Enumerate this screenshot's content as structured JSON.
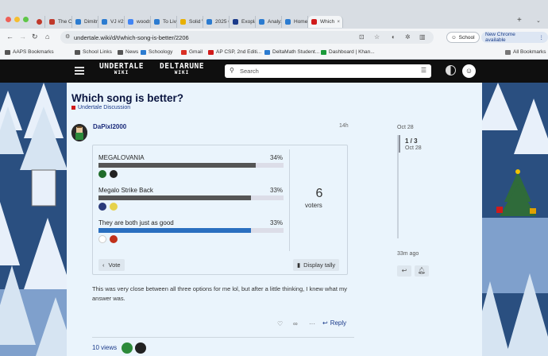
{
  "browser": {
    "tabs": [
      {
        "title": "The Or",
        "color": "#c0392b"
      },
      {
        "title": "Dimitri",
        "color": "#2b7bd0"
      },
      {
        "title": "VJ #2 -",
        "color": "#2b7bd0"
      },
      {
        "title": "woods",
        "color": "#4285f4"
      },
      {
        "title": "To Livi",
        "color": "#2b7bd0"
      },
      {
        "title": "Solid W",
        "color": "#e8b000"
      },
      {
        "title": "2025 C",
        "color": "#2b7bd0"
      },
      {
        "title": "Exoplan",
        "color": "#1a3a8a"
      },
      {
        "title": "Analyz",
        "color": "#2b7bd0"
      },
      {
        "title": "Home |",
        "color": "#2b7bd0"
      },
      {
        "title": "Which",
        "color": "#d01a1a"
      }
    ],
    "new_tab": "+",
    "url": "undertale.wiki/d/t/which-song-is-better/2206",
    "profile": "School",
    "update_label": "New Chrome available",
    "bookmarks": [
      {
        "label": "AAPS Bookmarks",
        "color": "#555"
      },
      {
        "label": "School Links",
        "color": "#555"
      },
      {
        "label": "News",
        "color": "#555"
      },
      {
        "label": "Schoology",
        "color": "#2b7bd0"
      },
      {
        "label": "Gmail",
        "color": "#d93025"
      },
      {
        "label": "AP CSP, 2nd Editi...",
        "color": "#d01a1a"
      },
      {
        "label": "DeltaMath Student...",
        "color": "#2b7bd0"
      },
      {
        "label": "Dashboard | Khan...",
        "color": "#1a9a3a"
      }
    ],
    "all_bookmarks": "All Bookmarks"
  },
  "site": {
    "logo_undertale": "UNDERTALE",
    "logo_deltarune": "DELTARUNE",
    "logo_wiki": "WIKI",
    "search_placeholder": "Search"
  },
  "topic": {
    "title": "Which song is better?",
    "category": "Undertale Discussion",
    "category_color": "#d01a1a"
  },
  "post": {
    "username": "DaPixl2000",
    "age": "14h",
    "body": "This was very close between all three options for me lol, but after a little thinking, I knew what my answer was.",
    "reply_label": "Reply",
    "views": "10 views"
  },
  "poll": {
    "options": [
      {
        "label": "MEGALOVANIA",
        "percent": "34%",
        "fraction": 0.34,
        "color": "#555555"
      },
      {
        "label": "Megalo Strike Back",
        "percent": "33%",
        "fraction": 0.33,
        "color": "#555555"
      },
      {
        "label": "They are both just as good",
        "percent": "33%",
        "fraction": 0.33,
        "color": "#2a6fc0"
      }
    ],
    "voters_count": "6",
    "voters_label": "voters",
    "vote_button": "Vote",
    "tally_button": "Display tally"
  },
  "timeline": {
    "start_date": "Oct 28",
    "position": "1 / 3",
    "current_date": "Oct 28",
    "end_label": "33m ago"
  }
}
